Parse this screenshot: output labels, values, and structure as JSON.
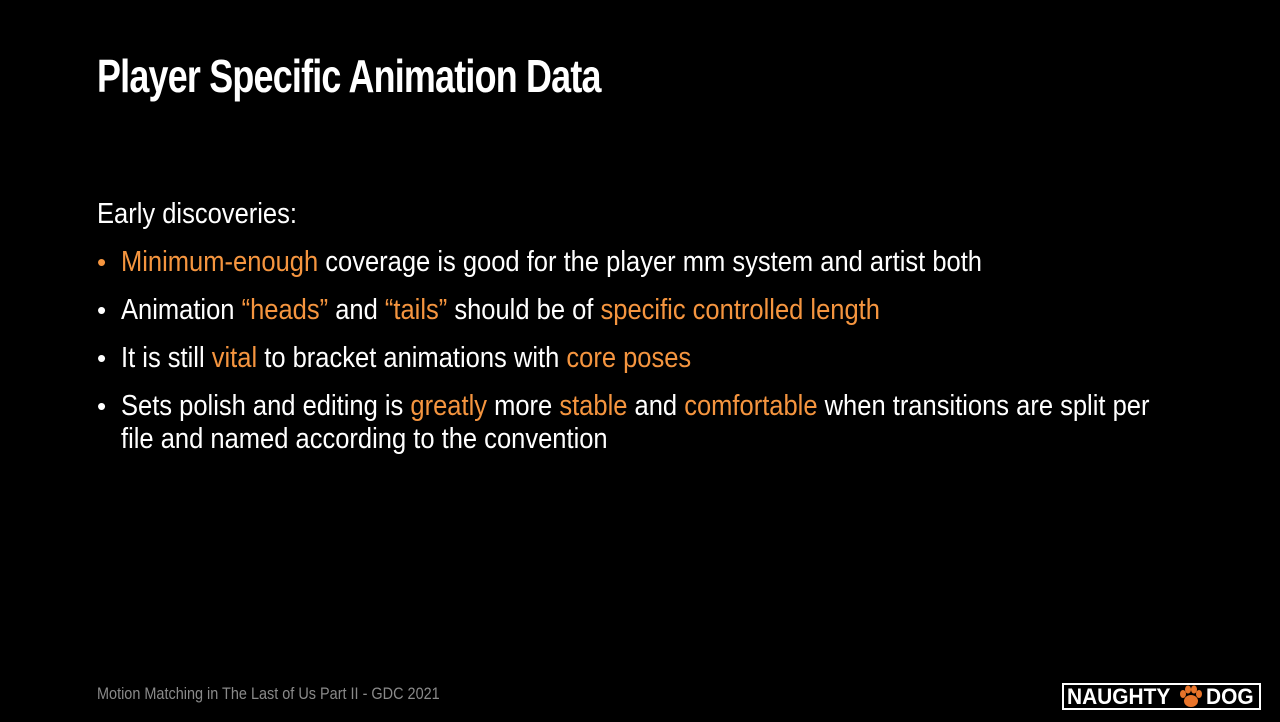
{
  "slide": {
    "title": "Player Specific Animation Data",
    "intro": "Early discoveries:",
    "bullets": [
      {
        "lines": [
          [
            {
              "text": "Minimum-enough",
              "highlight": true
            },
            {
              "text": " coverage is good for the player mm system and artist both",
              "highlight": false
            }
          ]
        ]
      },
      {
        "lines": [
          [
            {
              "text": "Animation ",
              "highlight": false
            },
            {
              "text": "“heads”",
              "highlight": true
            },
            {
              "text": " and ",
              "highlight": false
            },
            {
              "text": "“tails”",
              "highlight": true
            },
            {
              "text": " should be of ",
              "highlight": false
            },
            {
              "text": "specific controlled length",
              "highlight": true
            }
          ]
        ]
      },
      {
        "lines": [
          [
            {
              "text": "It is still ",
              "highlight": false
            },
            {
              "text": "vital",
              "highlight": true
            },
            {
              "text": " to bracket animations with ",
              "highlight": false
            },
            {
              "text": "core poses",
              "highlight": true
            }
          ]
        ]
      },
      {
        "lines": [
          [
            {
              "text": "Sets polish and editing is ",
              "highlight": false
            },
            {
              "text": "greatly",
              "highlight": true
            },
            {
              "text": " more ",
              "highlight": false
            },
            {
              "text": "stable",
              "highlight": true
            },
            {
              "text": " and ",
              "highlight": false
            },
            {
              "text": "comfortable",
              "highlight": true
            },
            {
              "text": " when transitions are split per",
              "highlight": false
            }
          ],
          [
            {
              "text": "file and named according to the convention",
              "highlight": false
            }
          ]
        ]
      }
    ],
    "footer": "Motion Matching in The Last of Us Part II - GDC 2021",
    "logo": {
      "left_word": "NAUGHTY",
      "right_word": "DOG",
      "icon": "paw-icon"
    }
  },
  "colors": {
    "background": "#000000",
    "text": "#ffffff",
    "highlight": "#f5953f",
    "footer": "#8a8a8a",
    "bullet_1_dot": "#f5953f",
    "bullet_dot": "#ffffff",
    "paw": "#e8742a"
  }
}
